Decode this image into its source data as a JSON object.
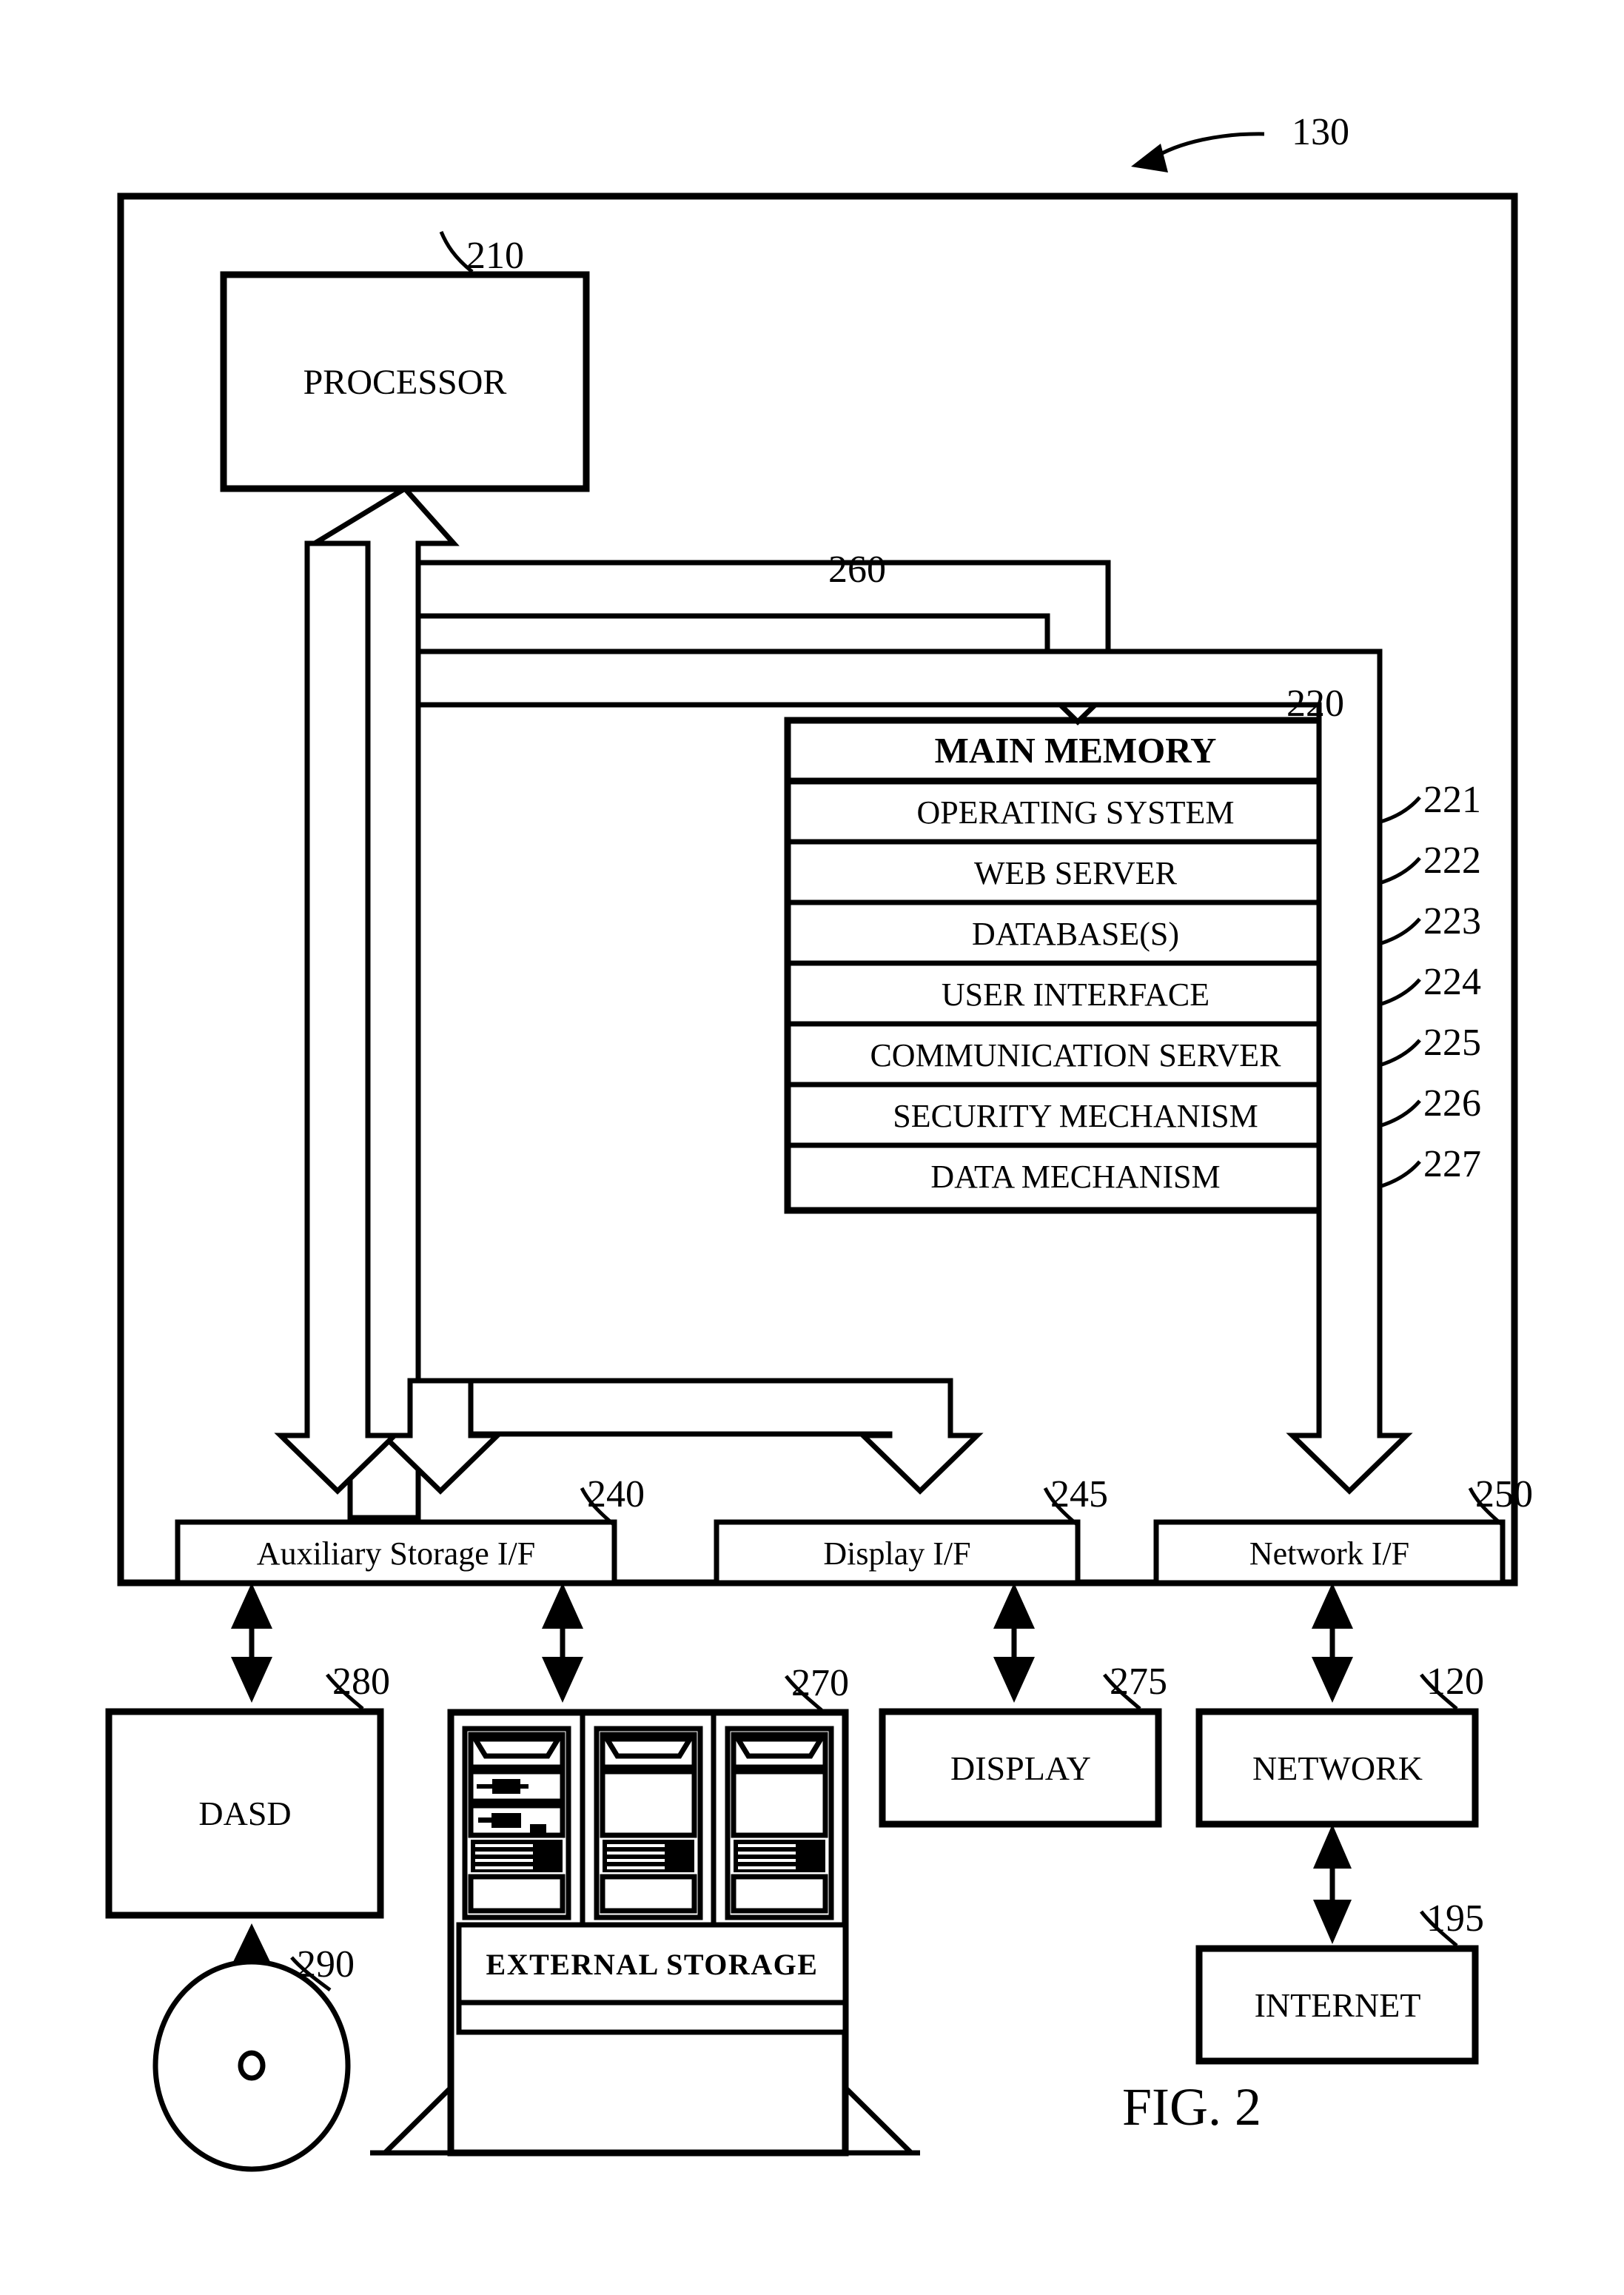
{
  "figure": {
    "caption": "FIG. 2",
    "system_ref": "130"
  },
  "processor": {
    "label": "PROCESSOR",
    "ref": "210"
  },
  "bus": {
    "ref": "260"
  },
  "main_memory": {
    "title": "MAIN MEMORY",
    "ref": "220",
    "rows": [
      {
        "label": "OPERATING SYSTEM",
        "ref": "221"
      },
      {
        "label": "WEB SERVER",
        "ref": "222"
      },
      {
        "label": "DATABASE(S)",
        "ref": "223"
      },
      {
        "label": "USER INTERFACE",
        "ref": "224"
      },
      {
        "label": "COMMUNICATION SERVER",
        "ref": "225"
      },
      {
        "label": "SECURITY MECHANISM",
        "ref": "226"
      },
      {
        "label": "DATA MECHANISM",
        "ref": "227"
      }
    ]
  },
  "interfaces": [
    {
      "label": "Auxiliary Storage I/F",
      "ref": "240"
    },
    {
      "label": "Display I/F",
      "ref": "245"
    },
    {
      "label": "Network I/F",
      "ref": "250"
    }
  ],
  "peripherals": {
    "dasd": {
      "label": "DASD",
      "ref": "280"
    },
    "disk": {
      "ref": "290"
    },
    "external_storage": {
      "label": "EXTERNAL STORAGE",
      "ref": "270"
    },
    "display": {
      "label": "DISPLAY",
      "ref": "275"
    },
    "network": {
      "label": "NETWORK",
      "ref": "120"
    },
    "internet": {
      "label": "INTERNET",
      "ref": "195"
    }
  },
  "colors": {
    "ink": "#000000",
    "paper": "#ffffff"
  }
}
